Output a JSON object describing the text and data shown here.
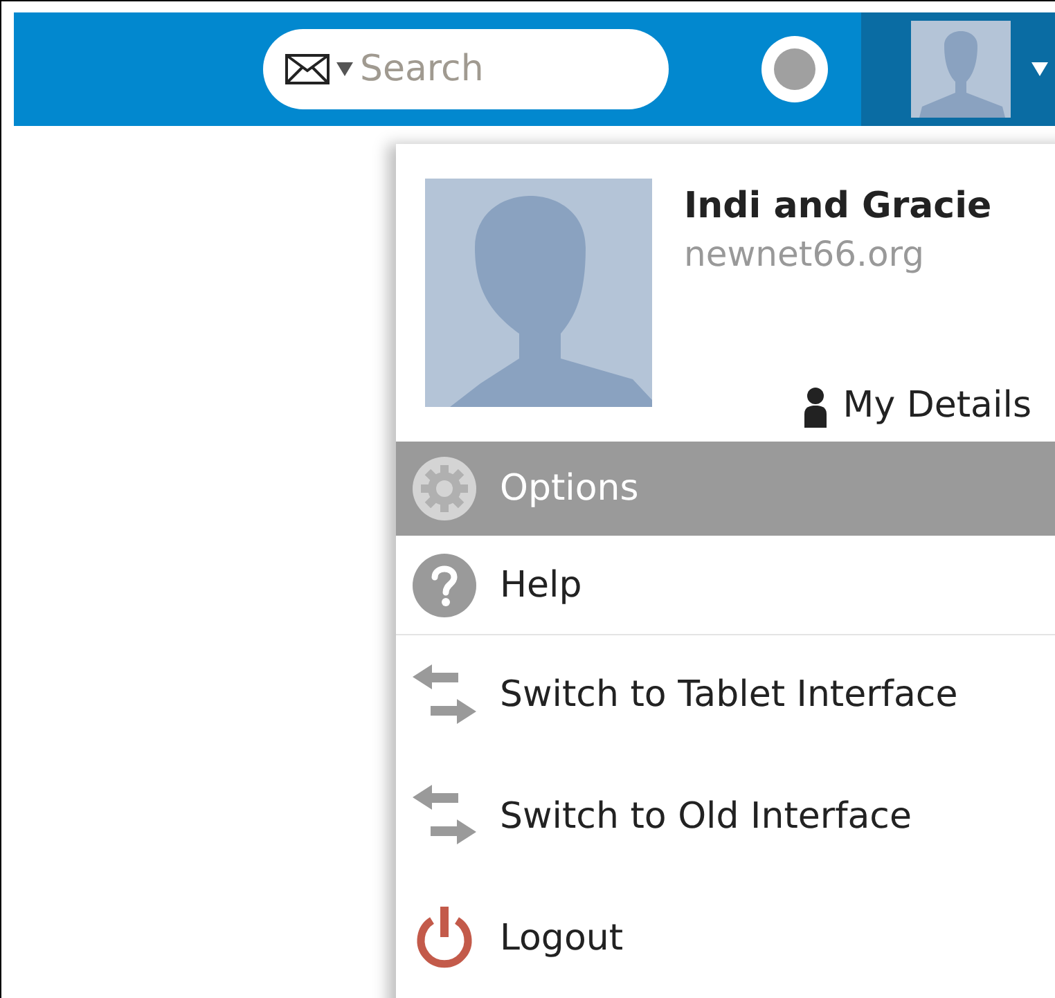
{
  "top_bar": {
    "search": {
      "placeholder": "Search"
    },
    "status": {
      "color": "#a0a0a0"
    }
  },
  "account_menu": {
    "name": "Indi and Gracie",
    "domain": "newnet66.org",
    "details_link": "My Details",
    "items": [
      {
        "kind": "options",
        "label": "Options",
        "selected": true
      },
      {
        "kind": "help",
        "label": "Help",
        "selected": false
      },
      {
        "kind": "switch",
        "label": "Switch to Tablet Interface",
        "selected": false
      },
      {
        "kind": "switch",
        "label": "Switch to Old Interface",
        "selected": false
      },
      {
        "kind": "logout",
        "label": "Logout",
        "selected": false
      }
    ]
  }
}
